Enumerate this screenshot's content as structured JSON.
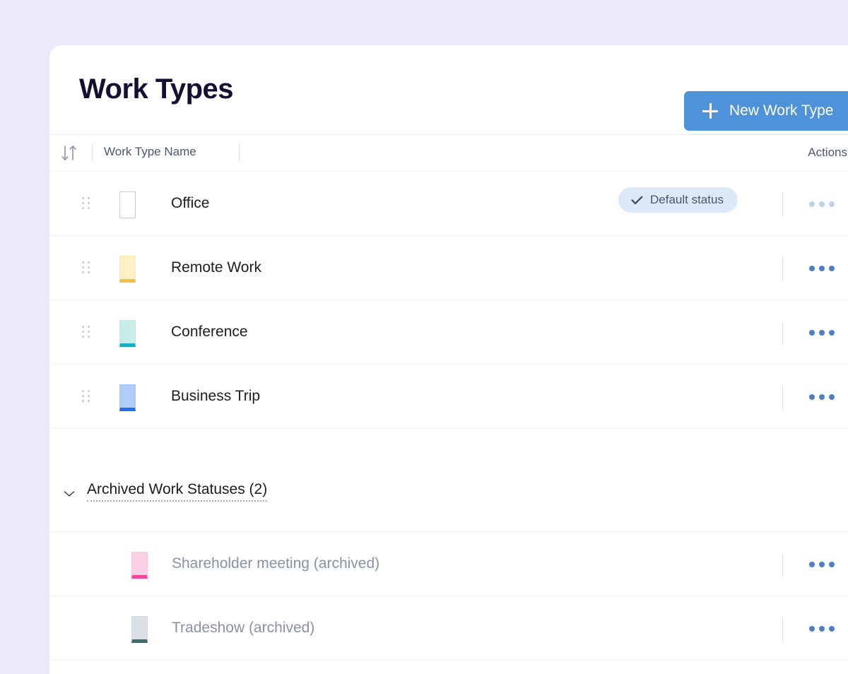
{
  "theme": {
    "page_background": "#ECE9FB",
    "card_background": "#FFFFFF",
    "accent_blue": "#4E93D9",
    "title_color": "#131034",
    "muted_text": "#8A90A6",
    "badge_background": "#DCE9F8"
  },
  "header": {
    "title": "Work Types",
    "new_button": {
      "label": "New Work Type",
      "icon": "plus-icon"
    }
  },
  "table": {
    "sort_icon": "sort-arrows-icon",
    "columns": {
      "name": "Work Type Name",
      "actions": "Actions"
    },
    "rows": [
      {
        "name": "Office",
        "swatch_fill": "#FFFFFF",
        "swatch_accent": "#C7CAD4",
        "swatch_border": "#C7CAD4",
        "draggable": true,
        "badge": {
          "label": "Default status",
          "icon": "check-icon"
        },
        "actions_icon": "more-horizontal-icon",
        "actions_muted": true
      },
      {
        "name": "Remote Work",
        "swatch_fill": "#FDF0C4",
        "swatch_accent": "#F2C23E",
        "swatch_border": "#FBE9B0",
        "draggable": true,
        "badge": null,
        "actions_icon": "more-horizontal-icon",
        "actions_muted": false
      },
      {
        "name": "Conference",
        "swatch_fill": "#C8EDE9",
        "swatch_accent": "#17ADBD",
        "swatch_border": "#BCE6E2",
        "draggable": true,
        "badge": null,
        "actions_icon": "more-horizontal-icon",
        "actions_muted": false
      },
      {
        "name": "Business Trip",
        "swatch_fill": "#AFCCFA",
        "swatch_accent": "#1F6FE8",
        "swatch_border": "#A7C6F8",
        "draggable": true,
        "badge": null,
        "actions_icon": "more-horizontal-icon",
        "actions_muted": false
      }
    ]
  },
  "archived_section": {
    "chevron_icon": "chevron-down-icon",
    "title": "Archived Work Statuses (2)",
    "rows": [
      {
        "name": "Shareholder meeting (archived)",
        "swatch_fill": "#FBCFE4",
        "swatch_accent": "#F6459B",
        "swatch_border": "#F9C6DE",
        "draggable": false,
        "actions_icon": "more-horizontal-icon",
        "actions_muted": false
      },
      {
        "name": "Tradeshow (archived)",
        "swatch_fill": "#DBE0E4",
        "swatch_accent": "#3E6B6B",
        "swatch_border": "#D3D8DD",
        "draggable": false,
        "actions_icon": "more-horizontal-icon",
        "actions_muted": false
      }
    ]
  }
}
